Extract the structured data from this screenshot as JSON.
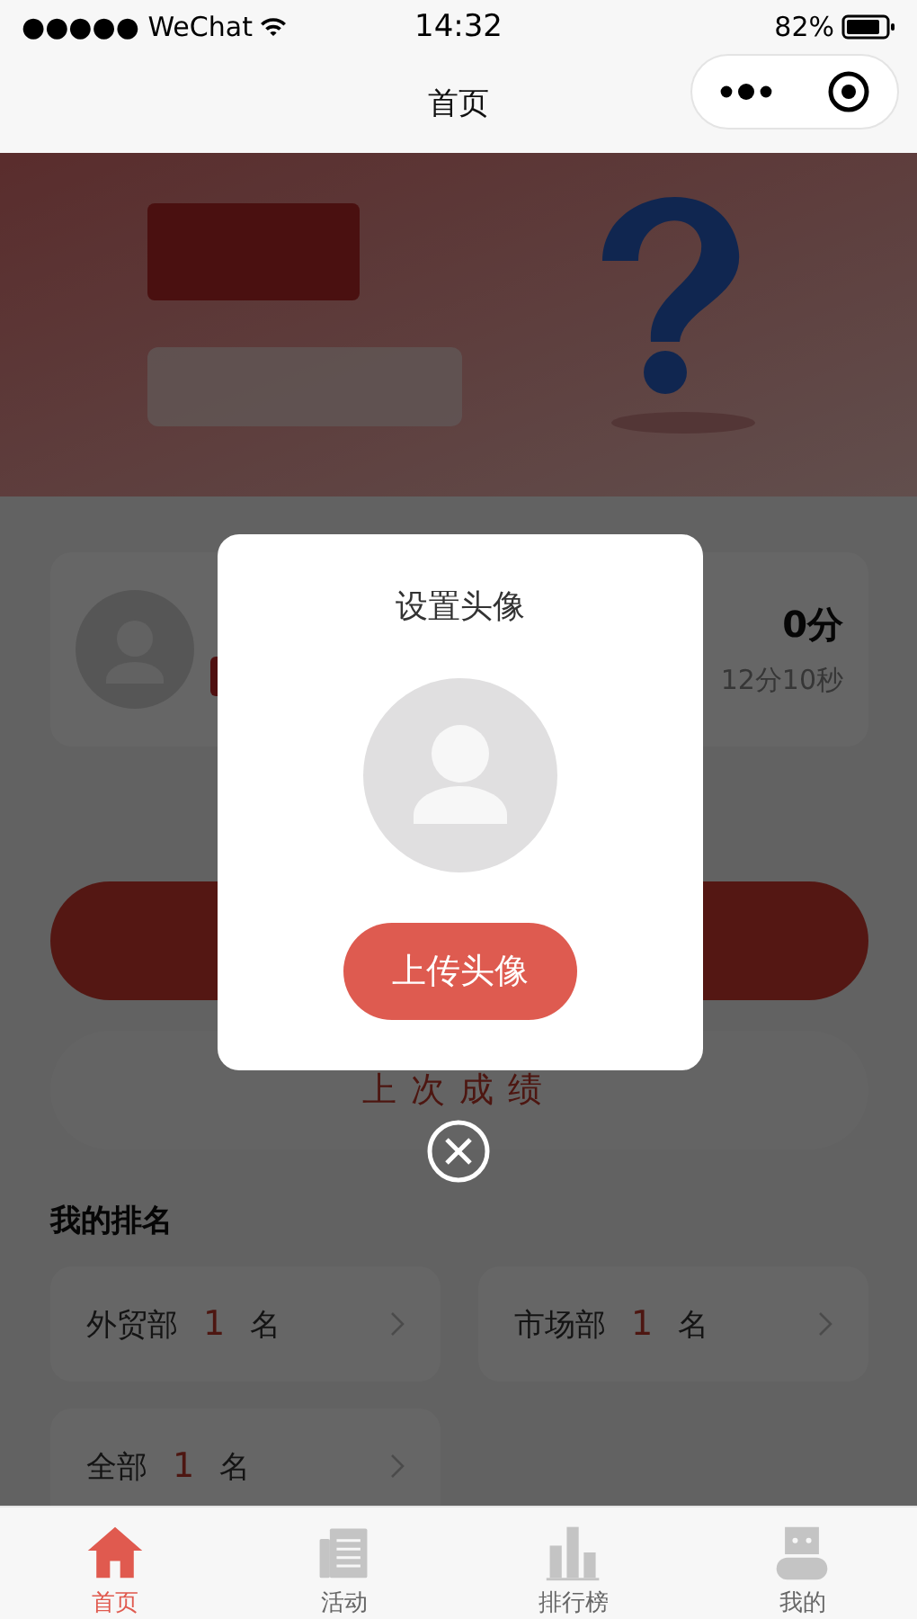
{
  "status_bar": {
    "carrier": "●●●●● WeChat",
    "time": "14:32",
    "battery": "82%"
  },
  "nav": {
    "title": "首页"
  },
  "profile": {
    "score": "0分",
    "time": "12分10秒"
  },
  "last_score": {
    "label": "上次成绩"
  },
  "ranking": {
    "title": "我的排名",
    "items": [
      {
        "dept": "外贸部",
        "rank": "1",
        "unit": "名"
      },
      {
        "dept": "市场部",
        "rank": "1",
        "unit": "名"
      },
      {
        "dept": "全部",
        "rank": "1",
        "unit": "名"
      }
    ]
  },
  "modal": {
    "title": "设置头像",
    "button": "上传头像"
  },
  "tabs": [
    {
      "kind": "home",
      "label": "首页",
      "selected": true
    },
    {
      "kind": "activity",
      "label": "活动",
      "selected": false
    },
    {
      "kind": "ranking",
      "label": "排行榜",
      "selected": false
    },
    {
      "kind": "mine",
      "label": "我的",
      "selected": false
    }
  ]
}
